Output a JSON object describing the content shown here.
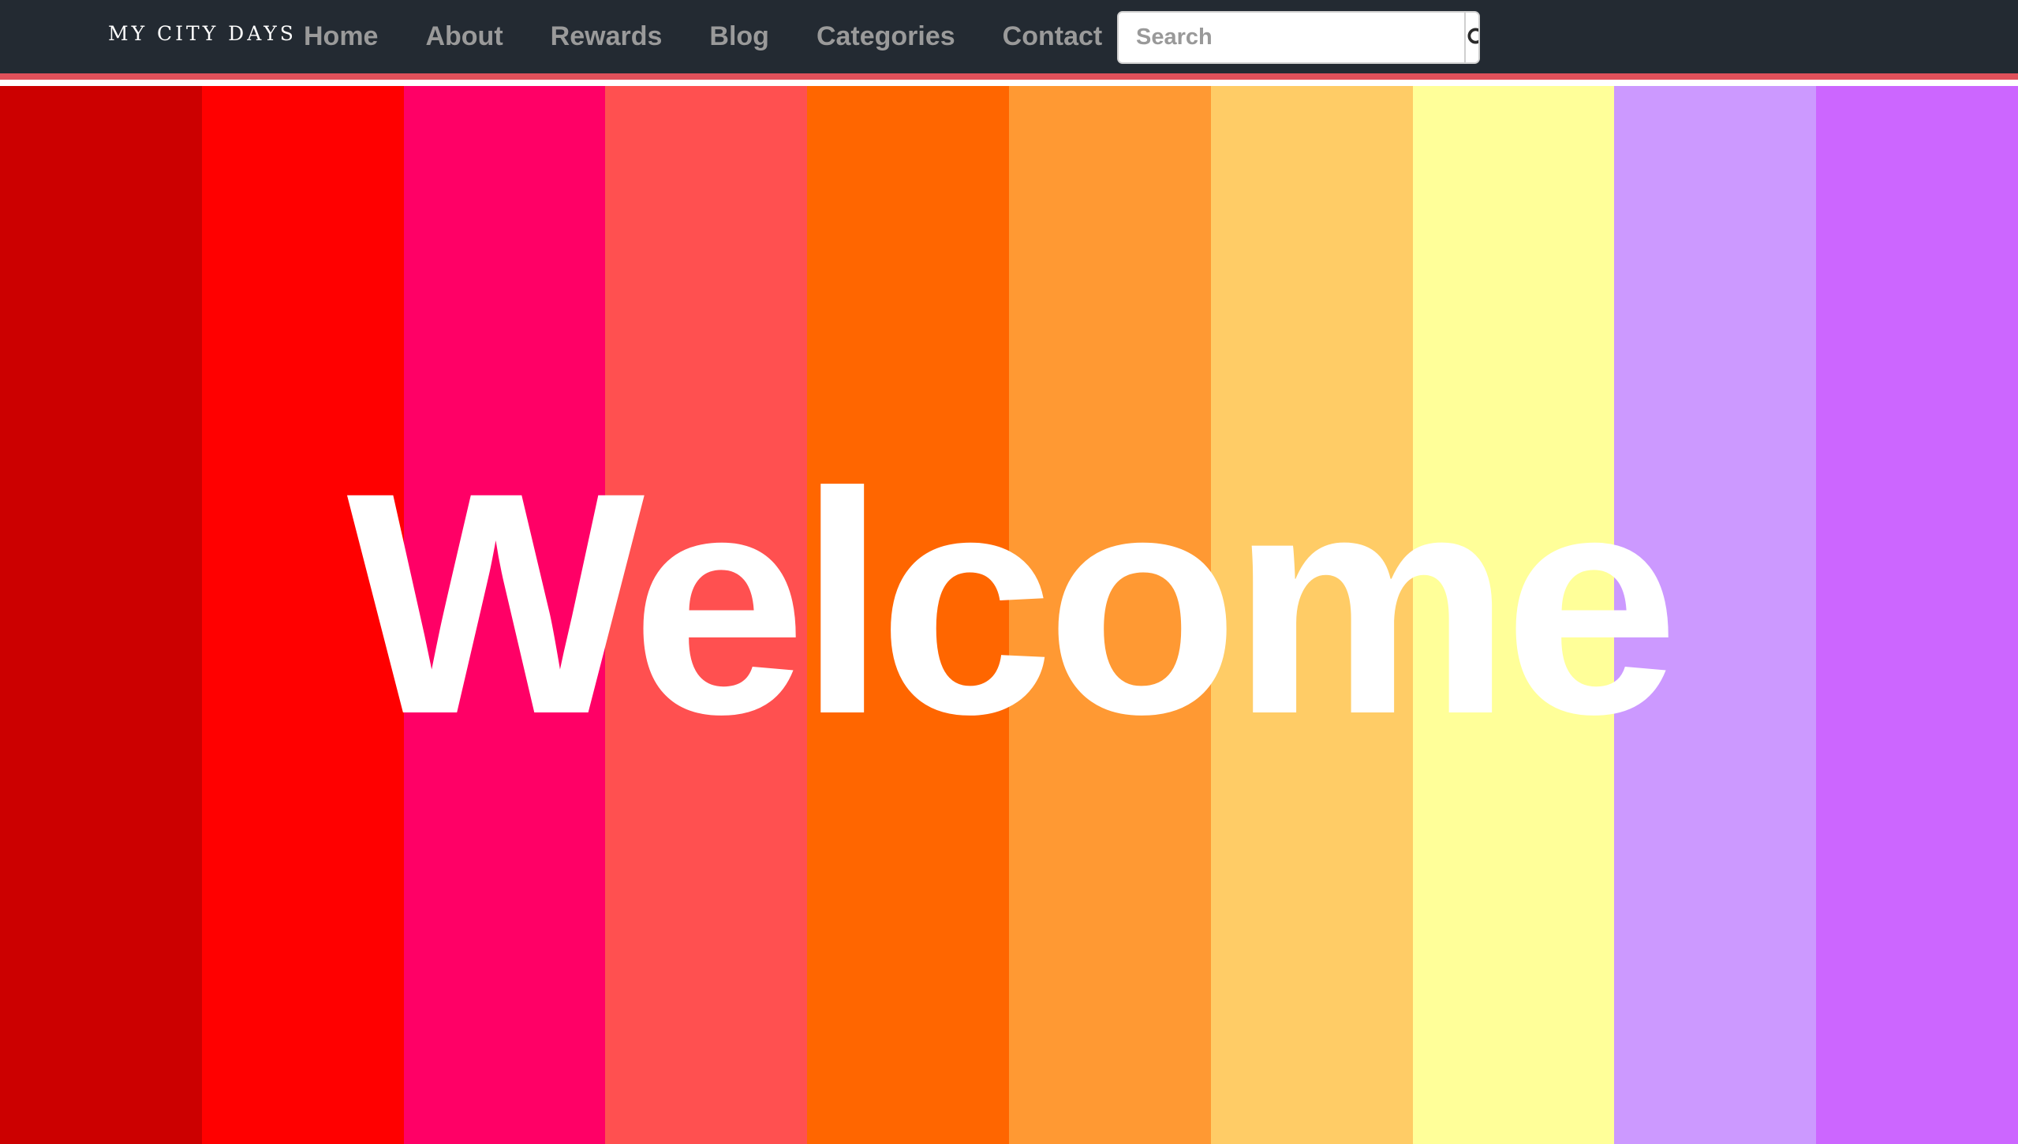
{
  "navbar": {
    "brand": "MY CITY DAYS",
    "links": [
      "Home",
      "About",
      "Rewards",
      "Blog",
      "Categories",
      "Contact"
    ],
    "search": {
      "placeholder": "Search",
      "icon": "search-icon"
    },
    "accent_border": "#e0505a",
    "background": "#232a32"
  },
  "hero": {
    "title": "Welcome",
    "stripes": [
      "#cc0000",
      "#ff0000",
      "#ff0066",
      "#ff5050",
      "#ff6600",
      "#ff9933",
      "#ffcc66",
      "#ffff99",
      "#cc99ff",
      "#cc66ff"
    ]
  }
}
